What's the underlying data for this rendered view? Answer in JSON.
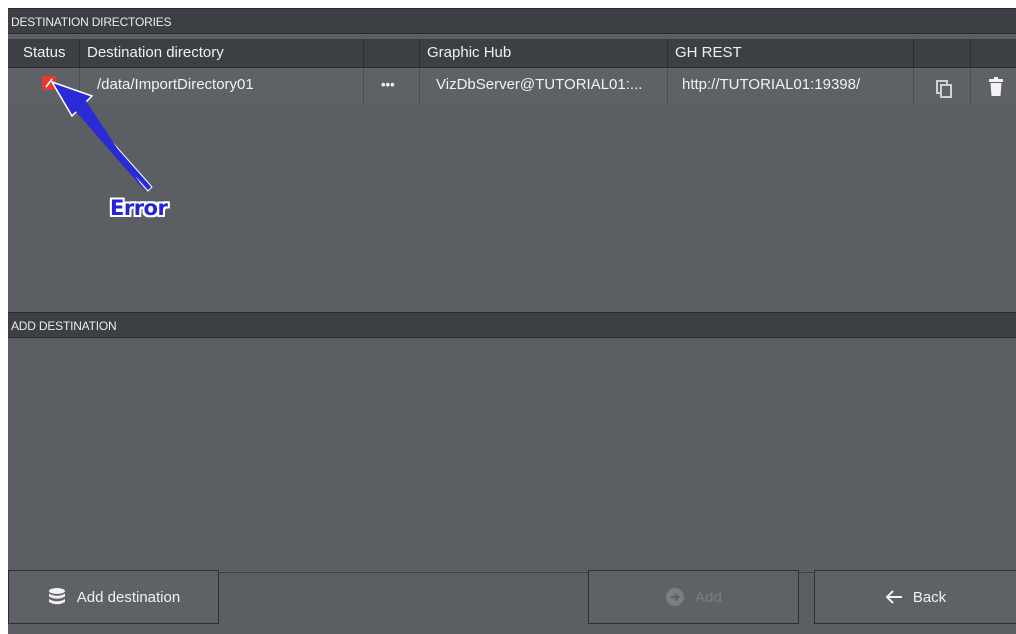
{
  "destination_directories": {
    "section_title": "DESTINATION DIRECTORIES",
    "columns": {
      "status": "Status",
      "destination_directory": "Destination directory",
      "graphic_hub": "Graphic Hub",
      "gh_rest": "GH REST"
    },
    "rows": [
      {
        "status": "error",
        "destination_directory": "/data/ImportDirectory01",
        "browse_label": "•••",
        "graphic_hub": "VizDbServer@TUTORIAL01:...",
        "gh_rest": "http://TUTORIAL01:19398/",
        "copy_icon": "copy-icon",
        "delete_icon": "trash-icon"
      }
    ]
  },
  "add_destination_section": {
    "section_title": "ADD DESTINATION"
  },
  "footer": {
    "add_destination_label": "Add destination",
    "add_destination_icon": "database-icon",
    "add_label": "Add",
    "add_icon": "arrow-circle-right-icon",
    "back_label": "Back",
    "back_icon": "arrow-left-icon"
  },
  "annotation": {
    "label": "Error",
    "color": "#2525d8"
  },
  "colors": {
    "error": "#e53a2f",
    "panel": "#5b5e62",
    "header": "#3c3f43"
  }
}
